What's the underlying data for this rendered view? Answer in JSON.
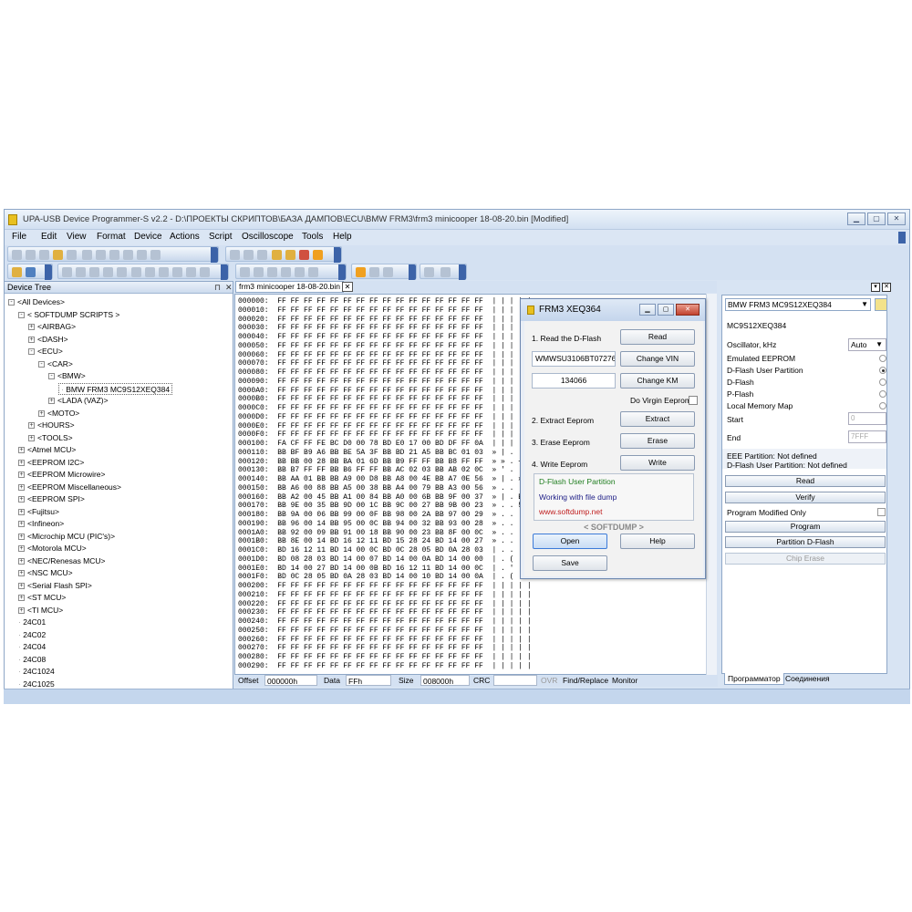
{
  "window": {
    "title": "UPA-USB Device Programmer-S v2.2 - D:\\ПРОЕКТЫ СКРИПТОВ\\БАЗА ДАМПОВ\\ECU\\BMW FRM3\\frm3 minicooper 18-08-20.bin [Modified]"
  },
  "menu": [
    "File",
    "Edit",
    "View",
    "Format",
    "Device",
    "Actions",
    "Script",
    "Oscilloscope",
    "Tools",
    "Help"
  ],
  "tree": {
    "title": "Device Tree",
    "nodes": [
      {
        "label": "<All Devices>",
        "indent": 0,
        "pm": "-"
      },
      {
        "label": "< SOFTDUMP SCRIPTS >",
        "indent": 1,
        "pm": "-"
      },
      {
        "label": "<AIRBAG>",
        "indent": 2,
        "pm": "+"
      },
      {
        "label": "<DASH>",
        "indent": 2,
        "pm": "+"
      },
      {
        "label": "<ECU>",
        "indent": 2,
        "pm": "-"
      },
      {
        "label": "<CAR>",
        "indent": 3,
        "pm": "-"
      },
      {
        "label": "<BMW>",
        "indent": 4,
        "pm": "-"
      },
      {
        "label": "BMW FRM3 MC9S12XEQ384",
        "indent": 5,
        "pm": "",
        "selected": true
      },
      {
        "label": "<LADA (VAZ)>",
        "indent": 4,
        "pm": "+"
      },
      {
        "label": "<MOTO>",
        "indent": 3,
        "pm": "+"
      },
      {
        "label": "<HOURS>",
        "indent": 2,
        "pm": "+"
      },
      {
        "label": "<TOOLS>",
        "indent": 2,
        "pm": "+"
      },
      {
        "label": "<Atmel MCU>",
        "indent": 1,
        "pm": "+"
      },
      {
        "label": "<EEPROM I2C>",
        "indent": 1,
        "pm": "+"
      },
      {
        "label": "<EEPROM Microwire>",
        "indent": 1,
        "pm": "+"
      },
      {
        "label": "<EEPROM Miscellaneous>",
        "indent": 1,
        "pm": "+"
      },
      {
        "label": "<EEPROM SPI>",
        "indent": 1,
        "pm": "+"
      },
      {
        "label": "<Fujitsu>",
        "indent": 1,
        "pm": "+"
      },
      {
        "label": "<Infineon>",
        "indent": 1,
        "pm": "+"
      },
      {
        "label": "<Microchip MCU (PIC's)>",
        "indent": 1,
        "pm": "+"
      },
      {
        "label": "<Motorola MCU>",
        "indent": 1,
        "pm": "+"
      },
      {
        "label": "<NEC/Renesas MCU>",
        "indent": 1,
        "pm": "+"
      },
      {
        "label": "<NSC MCU>",
        "indent": 1,
        "pm": "+"
      },
      {
        "label": "<Serial Flash SPI>",
        "indent": 1,
        "pm": "+"
      },
      {
        "label": "<ST MCU>",
        "indent": 1,
        "pm": "+"
      },
      {
        "label": "<TI MCU>",
        "indent": 1,
        "pm": "+"
      },
      {
        "label": "24C01",
        "indent": 1,
        "pm": ""
      },
      {
        "label": "24C02",
        "indent": 1,
        "pm": ""
      },
      {
        "label": "24C04",
        "indent": 1,
        "pm": ""
      },
      {
        "label": "24C08",
        "indent": 1,
        "pm": ""
      },
      {
        "label": "24C1024",
        "indent": 1,
        "pm": ""
      },
      {
        "label": "24C1025",
        "indent": 1,
        "pm": ""
      }
    ]
  },
  "hex": {
    "tab": "frm3 minicooper 18-08-20.bin",
    "lines": [
      "000000:  FF FF FF FF FF FF FF FF FF FF FF FF FF FF FF FF  | | | | |",
      "000010:  FF FF FF FF FF FF FF FF FF FF FF FF FF FF FF FF  | | | | |",
      "000020:  FF FF FF FF FF FF FF FF FF FF FF FF FF FF FF FF  | | | | |",
      "000030:  FF FF FF FF FF FF FF FF FF FF FF FF FF FF FF FF  | | | | |",
      "000040:  FF FF FF FF FF FF FF FF FF FF FF FF FF FF FF FF  | | | | |",
      "000050:  FF FF FF FF FF FF FF FF FF FF FF FF FF FF FF FF  | | | | |",
      "000060:  FF FF FF FF FF FF FF FF FF FF FF FF FF FF FF FF  | | | | |",
      "000070:  FF FF FF FF FF FF FF FF FF FF FF FF FF FF FF FF  | | | | |",
      "000080:  FF FF FF FF FF FF FF FF FF FF FF FF FF FF FF FF  | | | | |",
      "000090:  FF FF FF FF FF FF FF FF FF FF FF FF FF FF FF FF  | | | | |",
      "0000A0:  FF FF FF FF FF FF FF FF FF FF FF FF FF FF FF FF  | | | | |",
      "0000B0:  FF FF FF FF FF FF FF FF FF FF FF FF FF FF FF FF  | | | | |",
      "0000C0:  FF FF FF FF FF FF FF FF FF FF FF FF FF FF FF FF  | | | | |",
      "0000D0:  FF FF FF FF FF FF FF FF FF FF FF FF FF FF FF FF  | | | | |",
      "0000E0:  FF FF FF FF FF FF FF FF FF FF FF FF FF FF FF FF  | | | | |",
      "0000F0:  FF FF FF FF FF FF FF FF FF FF FF FF FF FF FF FF  | | | | |",
      "000100:  FA CF FF FE BC D0 00 78 BD E0 17 00 BD DF FF 0A  | | | |",
      "000110:  BB BF B9 A6 BB BE 5A 3F BB BD 21 A5 BB BC 01 03  » | . . |",
      "000120:  BB BB 00 28 BB BA 01 6D BB B9 FF FF BB B8 FF FF  » » . + »",
      "000130:  BB B7 FF FF BB B6 FF FF BB AC 02 03 BB AB 02 0C  » ' . | ¶",
      "000140:  BB AA 01 BB BB A9 00 D8 BB A8 00 4E BB A7 0E 56  » | . » »",
      "000150:  BB A6 00 88 BB A5 00 38 BB A4 00 79 BB A3 00 56  » . . . .",
      "000160:  BB A2 00 45 BB A1 00 84 BB A0 00 6B BB 9F 00 37  » | . E .",
      "000170:  BB 9E 00 35 BB 9D 00 1C BB 9C 00 27 BB 9B 00 23  » . . 5 »",
      "000180:  BB 9A 00 06 BB 99 00 0F BB 98 00 2A BB 97 00 29  » . . . .",
      "000190:  BB 96 00 14 BB 95 00 0C BB 94 00 32 BB 93 00 28  » . . . .",
      "0001A0:  BB 92 00 09 BB 91 00 18 BB 90 00 23 BB 8F 00 0C  » . . . .",
      "0001B0:  BB 8E 00 14 BD 16 12 11 BD 15 28 24 BD 14 00 27  » . . . .",
      "0001C0:  BD 16 12 11 BD 14 00 0C BD 0C 28 05 BD 0A 28 03  | . . . .",
      "0001D0:  BD 08 28 03 BD 14 00 07 BD 14 00 0A BD 14 00 00  | . ( . .",
      "0001E0:  BD 14 00 27 BD 14 00 0B BD 16 12 11 BD 14 00 0C  | . ' . .",
      "0001F0:  BD 0C 28 05 BD 0A 28 03 BD 14 00 10 BD 14 00 0A  | . ( . .",
      "000200:  FF FF FF FF FF FF FF FF FF FF FF FF FF FF FF FF  | | | | |",
      "000210:  FF FF FF FF FF FF FF FF FF FF FF FF FF FF FF FF  | | | | |",
      "000220:  FF FF FF FF FF FF FF FF FF FF FF FF FF FF FF FF  | | | | |",
      "000230:  FF FF FF FF FF FF FF FF FF FF FF FF FF FF FF FF  | | | | |",
      "000240:  FF FF FF FF FF FF FF FF FF FF FF FF FF FF FF FF  | | | | |",
      "000250:  FF FF FF FF FF FF FF FF FF FF FF FF FF FF FF FF  | | | | |",
      "000260:  FF FF FF FF FF FF FF FF FF FF FF FF FF FF FF FF  | | | | |",
      "000270:  FF FF FF FF FF FF FF FF FF FF FF FF FF FF FF FF  | | | | |",
      "000280:  FF FF FF FF FF FF FF FF FF FF FF FF FF FF FF FF  | | | | |",
      "000290:  FF FF FF FF FF FF FF FF FF FF FF FF FF FF FF FF  | | | | |"
    ],
    "status": {
      "offset_label": "Offset",
      "offset": "000000h",
      "data_label": "Data",
      "data": "FFh",
      "size_label": "Size",
      "size": "008000h",
      "crc_label": "CRC",
      "crc": "",
      "ovr": "OVR",
      "find": "Find/Replace",
      "monitor": "Monitor"
    }
  },
  "right": {
    "device_select": "BMW FRM3 MC9S12XEQ384",
    "chip": "MC9S12XEQ384",
    "osc_label": "Oscillator, kHz",
    "osc_value": "Auto",
    "radios": [
      {
        "label": "Emulated EEPROM",
        "on": false
      },
      {
        "label": "D-Flash User Partition",
        "on": true
      },
      {
        "label": "D-Flash",
        "on": false
      },
      {
        "label": "P-Flash",
        "on": false
      },
      {
        "label": "Local Memory Map",
        "on": false
      }
    ],
    "start_label": "Start",
    "start_value": "0",
    "end_label": "End",
    "end_value": "7FFF",
    "info1": "EEE Partition: Not defined",
    "info2": "D-Flash User Partition: Not defined",
    "read": "Read",
    "verify": "Verify",
    "pmo_label": "Program Modified Only",
    "program": "Program",
    "partition": "Partition D-Flash",
    "chip_erase": "Chip Erase",
    "tabs": [
      "Программатор",
      "Соединения"
    ]
  },
  "dialog": {
    "title": "FRM3 XEQ364",
    "read_label": "1. Read the D-Flash",
    "read_btn": "Read",
    "vin": "WMWSU3106BT072767",
    "change_vin": "Change VIN",
    "km": "134066",
    "change_km": "Change KM",
    "virgin": "Do Virgin Eeprom",
    "extract_label": "2. Extract Eeprom",
    "extract_btn": "Extract",
    "erase_label": "3. Erase Eeprom",
    "erase_btn": "Erase",
    "write_label": "4. Write Eeprom",
    "write_btn": "Write",
    "info1": "D-Flash User Partition",
    "info2": "Working with file dump",
    "info3": "www.softdump.net",
    "brand": "< SOFTDUMP >",
    "open": "Open",
    "help": "Help",
    "save": "Save"
  }
}
